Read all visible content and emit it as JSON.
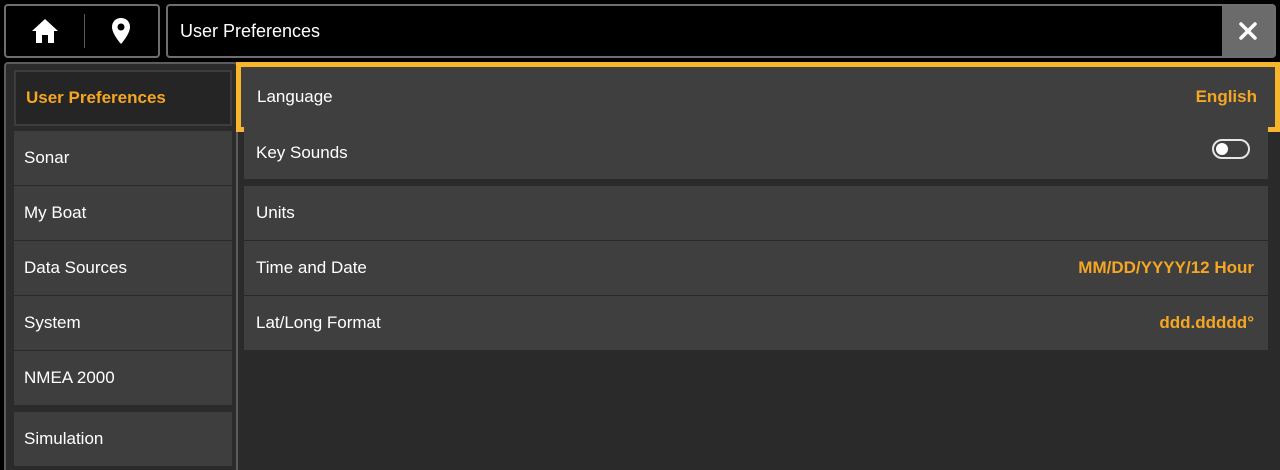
{
  "header": {
    "title": "User Preferences",
    "home_icon": "home-icon",
    "location_icon": "map-pin-icon",
    "close_icon": "close-icon"
  },
  "sidebar": {
    "items": [
      {
        "label": "User Preferences",
        "active": true
      },
      {
        "label": "Sonar"
      },
      {
        "label": "My Boat"
      },
      {
        "label": "Data Sources"
      },
      {
        "label": "System"
      },
      {
        "label": "NMEA 2000"
      },
      {
        "label": "Simulation"
      }
    ]
  },
  "settings": {
    "rows": [
      {
        "label": "Language",
        "value": "English",
        "selected": true
      },
      {
        "label": "Key Sounds",
        "toggle": false
      },
      {
        "label": "Units",
        "value": ""
      },
      {
        "label": "Time and Date",
        "value": "MM/DD/YYYY/12 Hour"
      },
      {
        "label": "Lat/Long Format",
        "value": "ddd.ddddd°"
      }
    ]
  },
  "colors": {
    "accent": "#f5a623",
    "highlight_border": "#f7b52b",
    "row_bg": "#3f3f40",
    "panel_bg": "#2a2a2b"
  }
}
